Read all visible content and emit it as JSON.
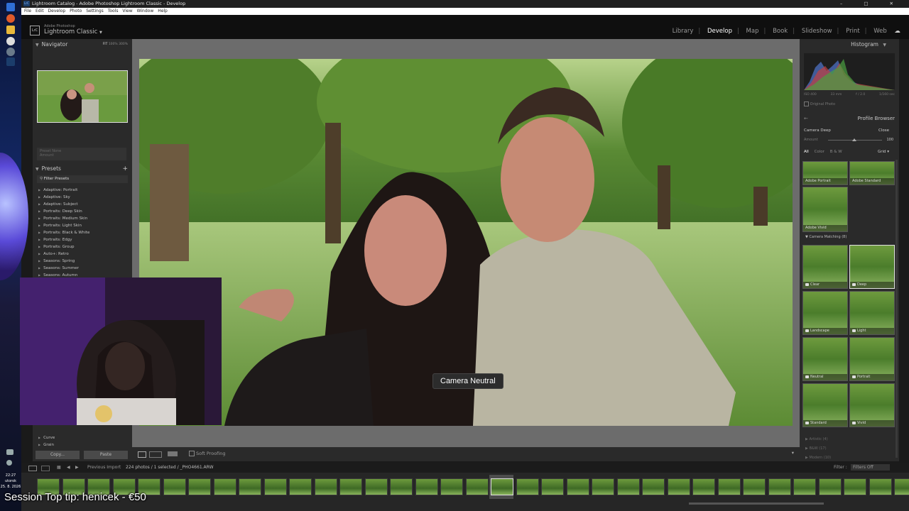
{
  "window": {
    "title": "Lightroom Catalog - Adobe Photoshop Lightroom Classic - Develop",
    "app_badge": "LrC",
    "controls": [
      "–",
      "□",
      "✕"
    ]
  },
  "menubar": [
    "File",
    "Edit",
    "Develop",
    "Photo",
    "Settings",
    "Tools",
    "View",
    "Window",
    "Help"
  ],
  "brand": {
    "small": "Adobe Photoshop",
    "name": "Lightroom Classic",
    "logo": "LrC",
    "caret": "▼"
  },
  "modules": [
    "Library",
    "Develop",
    "Map",
    "Book",
    "Slideshow",
    "Print",
    "Web"
  ],
  "active_module": "Develop",
  "left_panel": {
    "navigator_label": "Navigator",
    "nav_zoom": [
      "FIT",
      "100%",
      "300%"
    ],
    "snapshot_row": [
      "Preset",
      "None"
    ],
    "amount_label": "Amount",
    "presets_label": "Presets",
    "filter_presets": "Filter Presets",
    "presets": [
      "Adaptive: Portrait",
      "Adaptive: Sky",
      "Adaptive: Subject",
      "Portraits: Deep Skin",
      "Portraits: Medium Skin",
      "Portraits: Light Skin",
      "Portraits: Black & White",
      "Portraits: Edgy",
      "Portraits: Group",
      "Auto+: Retro",
      "Seasons: Spring",
      "Seasons: Summer",
      "Seasons: Autumn"
    ],
    "lower_panels": [
      "Curve",
      "Grain"
    ],
    "copy_label": "Copy...",
    "paste_label": "Paste"
  },
  "main": {
    "tooltip": "Camera Neutral",
    "toolbar_label": "Soft Proofing"
  },
  "right_panel": {
    "histogram_label": "Histogram",
    "exif": [
      "ISO 400",
      "33 mm",
      "f / 2.0",
      "1/160 sec"
    ],
    "original_photo": "Original Photo",
    "profile_browser_label": "Profile Browser",
    "current_profile": "Camera Deep",
    "close_label": "Close",
    "amount_label": "Amount",
    "amount_value": "100",
    "filters": [
      "All",
      "Color",
      "B & W"
    ],
    "grid_label": "Grid",
    "group_camera_matching": "Camera Matching (8)",
    "profiles_top": [
      "Adobe Portrait",
      "Adobe Standard",
      "Adobe Vivid"
    ],
    "profiles_camera": [
      "Clear",
      "Deep",
      "Landscape",
      "Light",
      "Neutral",
      "Portrait",
      "Standard",
      "Vivid"
    ],
    "selected_profile": "Deep",
    "collapsed_groups": [
      "Artistic (4)",
      "B&W (17)",
      "Modern (10)"
    ]
  },
  "filmstrip": {
    "source": "Previous Import",
    "count": "224 photos / 1 selected / _PHO4661.ARW",
    "filter_label": "Filter :",
    "filter_value": "Filters Off",
    "thumb_count": 35,
    "selected_index": 18
  },
  "taskbar": {
    "time": "22:27",
    "day": "utorok",
    "date": "25. 8. 2026"
  },
  "stream_banner": "Session Top tip: henicek - €50"
}
